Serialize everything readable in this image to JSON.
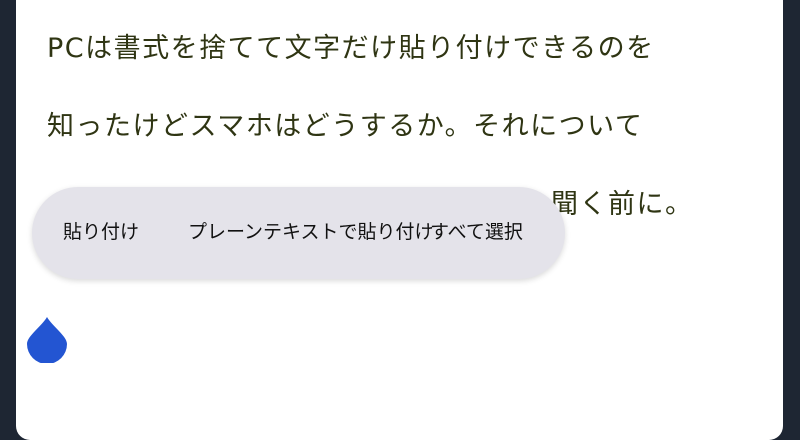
{
  "document": {
    "line1": "PCは書式を捨てて文字だけ貼り付けできるのを",
    "line2": "知ったけどスマホはどうするか。それについて",
    "line3": "聞く前に。"
  },
  "context_menu": {
    "paste": "貼り付け",
    "paste_plain_text": "プレーンテキストで貼り付け",
    "select_all": "すべて選択"
  },
  "colors": {
    "background": "#1e2633",
    "text": "#2f3513",
    "menu_background": "#e4e3ea",
    "handle": "#2355d2"
  },
  "icons": {
    "cursor_handle": "text-cursor-handle-icon"
  }
}
